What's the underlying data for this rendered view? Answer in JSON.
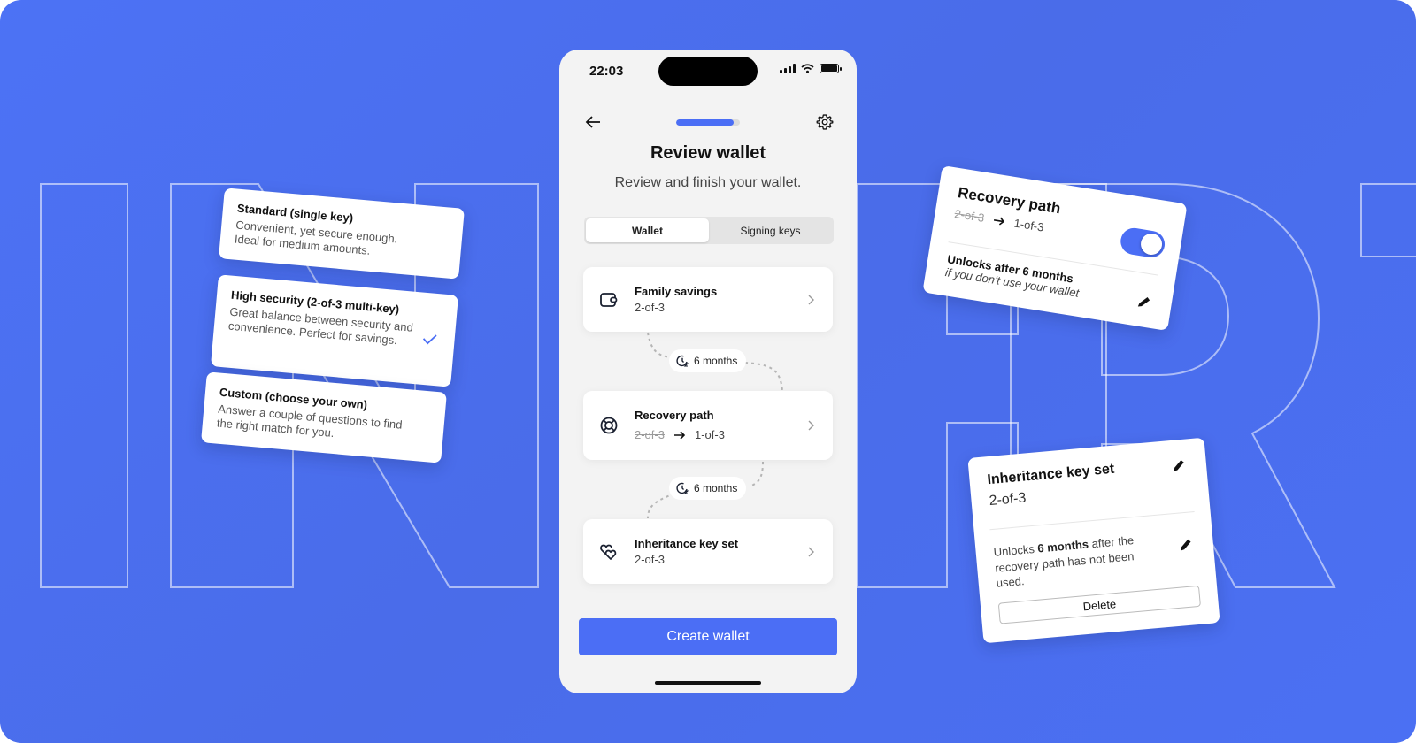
{
  "status_bar": {
    "time": "22:03"
  },
  "nav": {
    "progress": 0.9
  },
  "screen": {
    "title": "Review wallet",
    "subtitle": "Review and finish your wallet."
  },
  "tabs": [
    {
      "label": "Wallet",
      "active": true
    },
    {
      "label": "Signing keys",
      "active": false
    }
  ],
  "wallet_items": [
    {
      "icon": "wallet-icon",
      "title": "Family savings",
      "sub": "2-of-3"
    },
    {
      "icon": "lifebuoy-icon",
      "title": "Recovery path",
      "sub_old": "2-of-3",
      "sub_new": "1-of-3"
    },
    {
      "icon": "hearts-icon",
      "title": "Inheritance key set",
      "sub": "2-of-3"
    }
  ],
  "timelocks": [
    {
      "label": "6 months"
    },
    {
      "label": "6 months"
    }
  ],
  "cta": {
    "label": "Create wallet"
  },
  "options": [
    {
      "title": "Standard (single key)",
      "desc": "Convenient, yet secure enough. Ideal for medium amounts.",
      "selected": false
    },
    {
      "title": "High security (2-of-3 multi-key)",
      "desc": "Great balance between security and convenience. Perfect for savings.",
      "selected": true
    },
    {
      "title": "Custom (choose your own)",
      "desc": "Answer a couple of questions to find the right match for you.",
      "selected": false
    }
  ],
  "recovery_card": {
    "title": "Recovery path",
    "old": "2-of-3",
    "new": "1-of-3",
    "enabled": true,
    "unlock_title": "Unlocks after 6 months",
    "unlock_sub": "if you don't use your wallet"
  },
  "inheritance_card": {
    "title": "Inheritance key set",
    "sub": "2-of-3",
    "desc_pre": "Unlocks ",
    "desc_bold": "6 months",
    "desc_post": " after the recovery path has not been used.",
    "delete_label": "Delete"
  },
  "colors": {
    "accent": "#4b6ef5",
    "background": "#4b70f3",
    "phone_bg": "#f3f3f3"
  }
}
